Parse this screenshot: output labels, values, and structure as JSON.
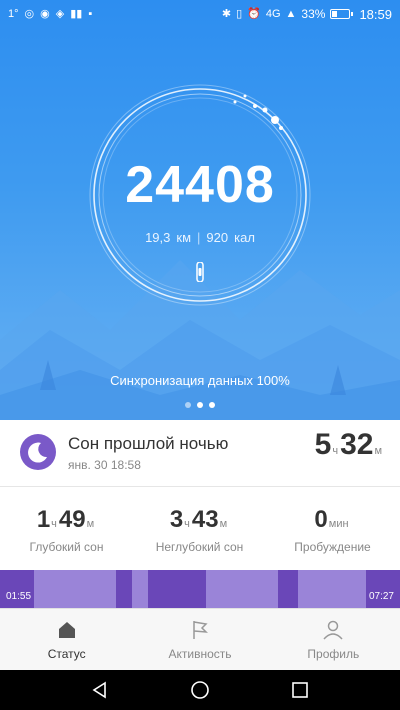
{
  "status_bar": {
    "left_items": [
      "1°",
      "◎",
      "◉",
      "◈",
      "▮▮",
      "▪"
    ],
    "right_items": [
      "✱",
      "▯",
      "⏰",
      "4G",
      "▲"
    ],
    "battery_percent": "33%",
    "battery_level": 0.33,
    "time": "18:59"
  },
  "activity": {
    "steps": "24408",
    "distance_value": "19,3",
    "distance_unit": "км",
    "separator": "|",
    "calories_value": "920",
    "calories_unit": "кал",
    "sync_text": "Синхронизация данных 100%",
    "page_dots": 3,
    "active_dot": 1
  },
  "sleep": {
    "title": "Сон прошлой ночью",
    "date": "янв. 30 18:58",
    "total_hours": "5",
    "hours_unit": "ч",
    "total_minutes": "32",
    "minutes_unit": "м",
    "metrics": [
      {
        "h": "1",
        "h_unit": "ч",
        "m": "49",
        "m_unit": "м",
        "label": "Глубокий сон"
      },
      {
        "h": "3",
        "h_unit": "ч",
        "m": "43",
        "m_unit": "м",
        "label": "Неглубокий сон"
      },
      {
        "h": "",
        "h_unit": "",
        "m": "0",
        "m_unit": "мин",
        "label": "Пробуждение"
      }
    ],
    "start_time": "01:55",
    "end_time": "07:27",
    "colors": {
      "deep": "#6a47b8",
      "light": "#9a84d8"
    }
  },
  "tabs": [
    {
      "label": "Статус",
      "icon": "home-icon",
      "active": true
    },
    {
      "label": "Активность",
      "icon": "flag-icon",
      "active": false
    },
    {
      "label": "Профиль",
      "icon": "person-icon",
      "active": false
    }
  ],
  "navigation": [
    "back-icon",
    "home-circle-icon",
    "recents-icon"
  ]
}
